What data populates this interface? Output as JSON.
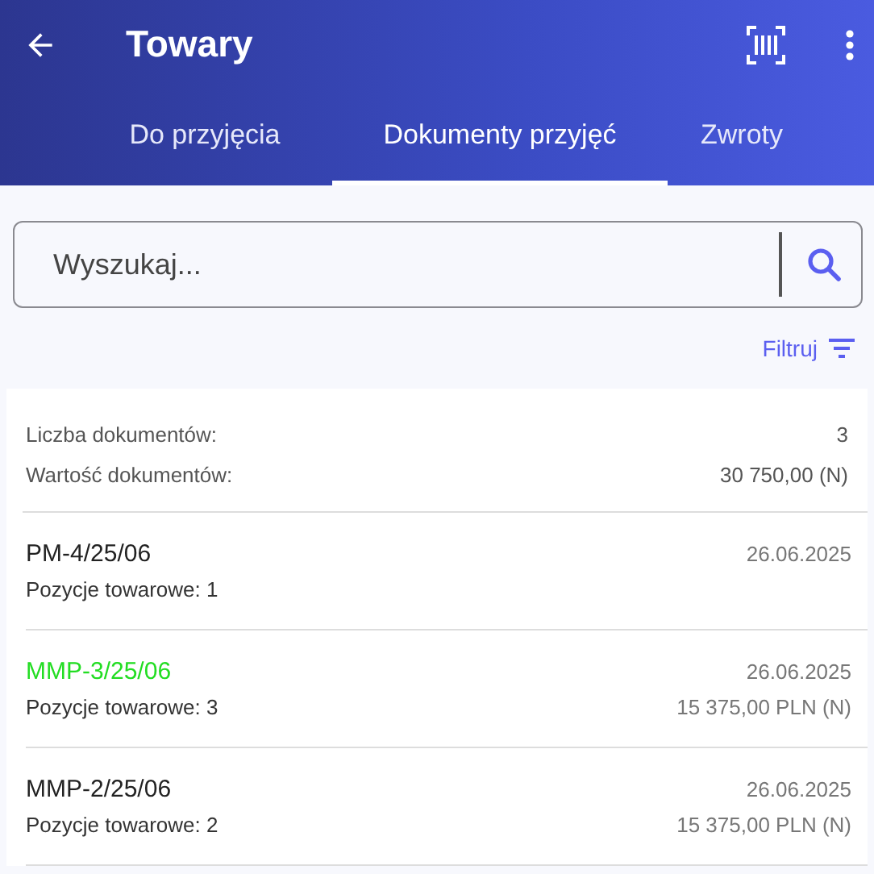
{
  "app_bar": {
    "title": "Towary"
  },
  "tabs": [
    {
      "label": "Do przyjęcia",
      "selected": false
    },
    {
      "label": "Dokumenty przyjęć",
      "selected": true
    },
    {
      "label": "Zwroty",
      "selected": false
    }
  ],
  "search": {
    "placeholder": "Wyszukaj..."
  },
  "filter": {
    "label": "Filtruj"
  },
  "summary": [
    {
      "label": "Liczba dokumentów:",
      "value": "3"
    },
    {
      "label": "Wartość dokumentów:",
      "value": "30 750,00 (N)"
    }
  ],
  "documents": [
    {
      "number": "PM-4/25/06",
      "date": "26.06.2025",
      "positions": "Pozycje towarowe: 1",
      "color": "#222222"
    },
    {
      "number": "MMP-3/25/06",
      "date": "26.06.2025",
      "positions": "Pozycje towarowe: 3",
      "value": "15 375,00 PLN (N)",
      "color": "#22dd22"
    },
    {
      "number": "MMP-2/25/06",
      "date": "26.06.2025",
      "positions": "Pozycje towarowe: 2",
      "value": "15 375,00 PLN (N)",
      "color": "#222222"
    }
  ]
}
